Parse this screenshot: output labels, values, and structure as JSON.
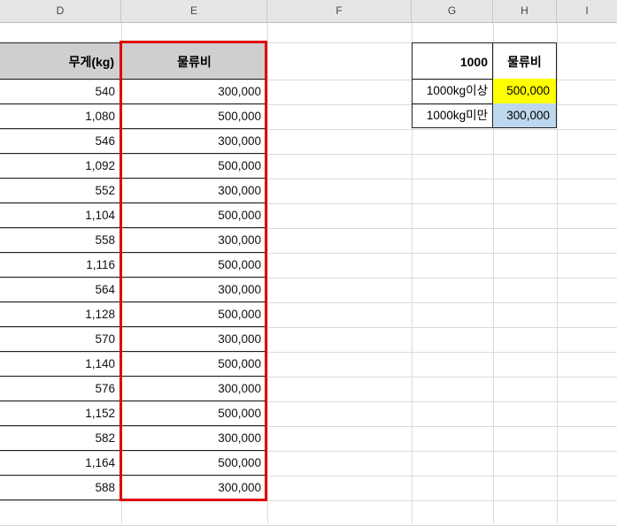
{
  "columns": [
    {
      "letter": "D"
    },
    {
      "letter": "E"
    },
    {
      "letter": "F"
    },
    {
      "letter": "G"
    },
    {
      "letter": "H"
    },
    {
      "letter": "I"
    }
  ],
  "table": {
    "weight_header": "무게(kg)",
    "cost_header": "물류비",
    "rows": [
      {
        "weight": "540",
        "cost": "300,000"
      },
      {
        "weight": "1,080",
        "cost": "500,000"
      },
      {
        "weight": "546",
        "cost": "300,000"
      },
      {
        "weight": "1,092",
        "cost": "500,000"
      },
      {
        "weight": "552",
        "cost": "300,000"
      },
      {
        "weight": "1,104",
        "cost": "500,000"
      },
      {
        "weight": "558",
        "cost": "300,000"
      },
      {
        "weight": "1,116",
        "cost": "500,000"
      },
      {
        "weight": "564",
        "cost": "300,000"
      },
      {
        "weight": "1,128",
        "cost": "500,000"
      },
      {
        "weight": "570",
        "cost": "300,000"
      },
      {
        "weight": "1,140",
        "cost": "500,000"
      },
      {
        "weight": "576",
        "cost": "300,000"
      },
      {
        "weight": "1,152",
        "cost": "500,000"
      },
      {
        "weight": "582",
        "cost": "300,000"
      },
      {
        "weight": "1,164",
        "cost": "500,000"
      },
      {
        "weight": "588",
        "cost": "300,000"
      }
    ]
  },
  "lookup": {
    "threshold": "1000",
    "cost_header": "물류비",
    "over_label": "1000kg이상",
    "over_value": "500,000",
    "under_label": "1000kg미만",
    "under_value": "300,000"
  },
  "colors": {
    "header_fill": "#d0cece",
    "selection_border": "#e00000",
    "over_fill": "#ffff00",
    "under_fill": "#bdd7ee"
  }
}
